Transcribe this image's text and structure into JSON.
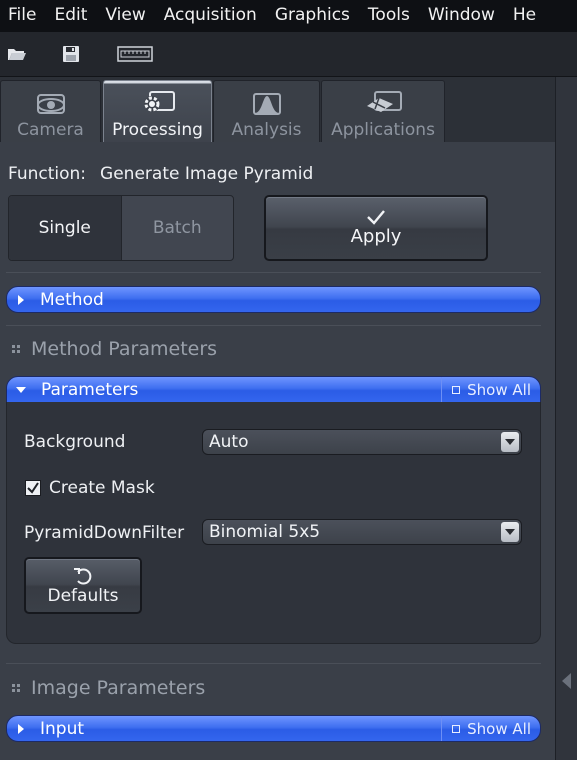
{
  "menu": {
    "items": [
      "File",
      "Edit",
      "View",
      "Acquisition",
      "Graphics",
      "Tools",
      "Window",
      "He"
    ]
  },
  "toolbar": {
    "icons": [
      "open-folder-icon",
      "save-icon",
      "ruler-icon"
    ]
  },
  "tabs": [
    {
      "label": "Camera",
      "icon": "camera-eye-icon",
      "active": false
    },
    {
      "label": "Processing",
      "icon": "gear-icon",
      "active": true
    },
    {
      "label": "Analysis",
      "icon": "histogram-icon",
      "active": false
    },
    {
      "label": "Applications",
      "icon": "applications-icon",
      "active": false
    }
  ],
  "function": {
    "label": "Function:",
    "value": "Generate Image Pyramid"
  },
  "mode": {
    "single": "Single",
    "batch": "Batch",
    "selected": "Single"
  },
  "apply": {
    "label": "Apply"
  },
  "method_bar": {
    "label": "Method"
  },
  "method_parameters": {
    "title": "Method Parameters"
  },
  "parameters_bar": {
    "label": "Parameters",
    "show_all": "Show All"
  },
  "params": {
    "background_label": "Background",
    "background_value": "Auto",
    "create_mask_label": "Create Mask",
    "create_mask_checked": true,
    "pyramid_label": "PyramidDownFilter",
    "pyramid_value": "Binomial 5x5",
    "defaults_label": "Defaults"
  },
  "image_parameters": {
    "title": "Image Parameters"
  },
  "input_bar": {
    "label": "Input",
    "show_all": "Show All"
  },
  "colors": {
    "accent_blue": "#3466ee",
    "panel_bg": "#3a3f48",
    "menubar_bg": "#0e1014"
  }
}
